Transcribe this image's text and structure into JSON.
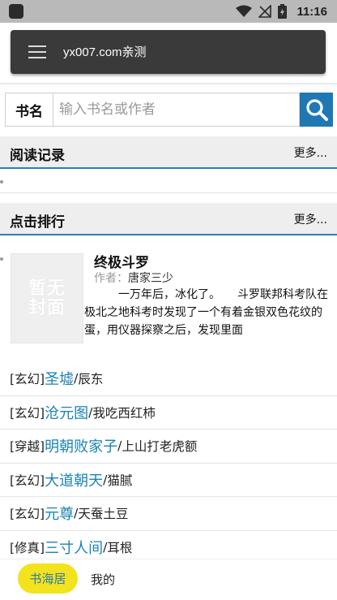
{
  "status_bar": {
    "time": "11:16",
    "icons": [
      "app-notification-icon",
      "wifi-icon",
      "no-signal-icon",
      "battery-charging-icon"
    ]
  },
  "app_bar": {
    "title": "yx007.com亲测",
    "menu_icon": "hamburger-menu-icon"
  },
  "search": {
    "label": "书名",
    "placeholder": "输入书名或作者",
    "button_icon": "search-icon",
    "button_color": "#1f78b4"
  },
  "reading_history": {
    "title": "阅读记录",
    "more": "更多..."
  },
  "ranking": {
    "title": "点击排行",
    "more": "更多...",
    "featured": {
      "cover_text": "暂无封面",
      "title": "终极斗罗",
      "author_label": "作者：",
      "author": "唐家三少",
      "description": "一万年后，冰化了。　　斗罗联邦科考队在极北之地科考时发现了一个有着金银双色花纹的蛋，用仪器探察之后，发现里面"
    },
    "items": [
      {
        "genre": "[玄幻]",
        "book": "圣墟",
        "sep": "/",
        "author": "辰东"
      },
      {
        "genre": "[玄幻]",
        "book": "沧元图",
        "sep": "/",
        "author": "我吃西红柿"
      },
      {
        "genre": "[穿越]",
        "book": "明朝败家子",
        "sep": "/",
        "author": "上山打老虎额"
      },
      {
        "genre": "[玄幻]",
        "book": "大道朝天",
        "sep": "/",
        "author": "猫腻"
      },
      {
        "genre": "[玄幻]",
        "book": "元尊",
        "sep": "/",
        "author": "天蚕土豆"
      },
      {
        "genre": "[修真]",
        "book": "三寸人间",
        "sep": "/",
        "author": "耳根"
      }
    ]
  },
  "bottom_nav": {
    "home": "书海居",
    "mine": "我的",
    "accent": "#f3e21e",
    "link_color": "#1b83b4"
  }
}
